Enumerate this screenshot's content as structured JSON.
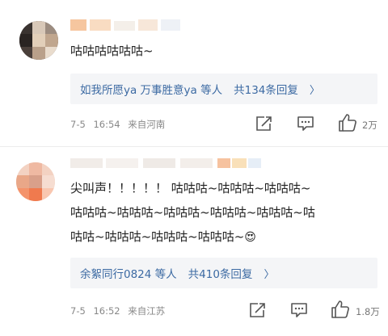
{
  "comments": [
    {
      "text_lines": [
        "咕咕咕咕咕咕~"
      ],
      "reply_summary": {
        "users": "如我所愿ya 万事胜意ya 等人",
        "count_text": "共134条回复",
        "chevron": "〉"
      },
      "date": "7-5",
      "time": "16:54",
      "location": "来自河南",
      "like_count": "2万"
    },
    {
      "text_lines": [
        "尖叫声！！！！！ 咕咕咕~咕咕咕~咕咕咕~",
        "咕咕咕~咕咕咕~咕咕咕~咕咕咕~咕咕咕~咕",
        "咕咕~咕咕咕~咕咕咕~咕咕咕~"
      ],
      "emoji": "😍",
      "reply_summary": {
        "users": "余絮同行0824 等人",
        "count_text": "共410条回复",
        "chevron": "〉"
      },
      "date": "7-5",
      "time": "16:52",
      "location": "来自江苏",
      "like_count": "1.8万"
    }
  ],
  "icons": {
    "share": "share-icon",
    "comment": "comment-icon",
    "like": "thumbs-up-icon"
  },
  "colors": {
    "link": "#3c6aa3",
    "reply_bg": "#f4f5f7",
    "meta": "#888888"
  }
}
